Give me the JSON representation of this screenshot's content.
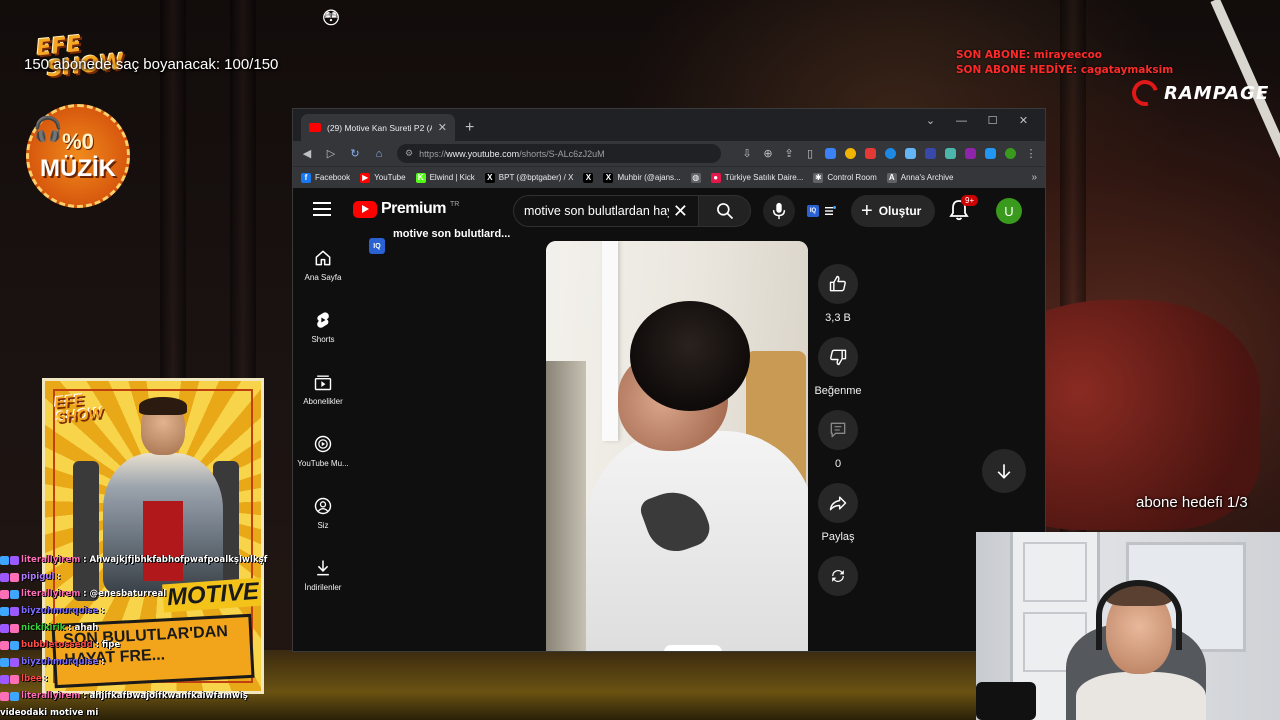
{
  "stream": {
    "goal_text": "150 abonede saç boyanacak: 100/150",
    "logo_line1": "EFE",
    "logo_line2": "SHOW",
    "badge_percent": "%0",
    "badge_word": "MÜZİK",
    "last_sub": "SON ABONE: mirayeecoo",
    "last_gift": "SON ABONE HEDİYE: cagataymaksim",
    "sponsor": "RAMPAGE",
    "sub_goal": "abone hedefi 1/3",
    "poster": {
      "logo1": "EFE",
      "logo2": "SHOW",
      "motive": "MOTIVE",
      "banner1": "SON BULUTLAR'DAN",
      "banner2": "HAYAT FRE..."
    },
    "chat": [
      {
        "user": "literallyirem",
        "msg": ": Ahwajkjfjbhkfabhofpwafpoalkşlwlkşf",
        "color": "#ff6fb5"
      },
      {
        "user": "pipigul",
        "msg": ":",
        "color": "#b07cff"
      },
      {
        "user": "literallyirem",
        "msg": ": @enesbaturreal",
        "color": "#ff6fb5"
      },
      {
        "user": "biyzuhmurquise",
        "msg": ":",
        "color": "#7c6cff"
      },
      {
        "user": "nickikirik",
        "msg": ": ahah",
        "color": "#3ecf3e"
      },
      {
        "user": "bubbletossedd",
        "msg": ": fipe",
        "color": "#ff4a4a"
      },
      {
        "user": "biyzuhmurquise",
        "msg": ":",
        "color": "#7c6cff"
      },
      {
        "user": "lbee",
        "msg": ":",
        "color": "#ff4a4a"
      },
      {
        "user": "literallyirem",
        "msg": ": ahjifkafbwajoifkwanfkaiwfamwiş",
        "color": "#ff6fb5"
      },
      {
        "user": "",
        "msg": "videodaki motive mi",
        "color": "#ffffff"
      }
    ]
  },
  "browser": {
    "tab_title": "(29) Motive Kan Sureti P2 (A",
    "url_prefix": "https://",
    "url_host": "www.youtube.com",
    "url_path": "/shorts/S-ALc6zJ2uM",
    "bookmarks": [
      {
        "label": "Facebook",
        "color": "#1877f2",
        "glyph": "f"
      },
      {
        "label": "YouTube",
        "color": "#ff0000",
        "glyph": "▶"
      },
      {
        "label": "Elwind | Kick",
        "color": "#53fc18",
        "glyph": "K"
      },
      {
        "label": "BPT (@bptgaber) / X",
        "color": "#000000",
        "glyph": "X"
      },
      {
        "label": "",
        "color": "#000000",
        "glyph": "X"
      },
      {
        "label": "Muhbir (@ajans...",
        "color": "#000000",
        "glyph": "X"
      },
      {
        "label": "",
        "color": "#5f6368",
        "glyph": "◍"
      },
      {
        "label": "Türkiye Satılık Daire...",
        "color": "#e3174a",
        "glyph": "●"
      },
      {
        "label": "Control Room",
        "color": "#5f6368",
        "glyph": "✱"
      },
      {
        "label": "Anna's Archive",
        "color": "#5f6368",
        "glyph": "A"
      }
    ]
  },
  "youtube": {
    "brand": "Premium",
    "region": "TR",
    "search_query": "motive son bulutlardan hayat",
    "create_label": "Oluştur",
    "notif_count": "9+",
    "avatar_letter": "U",
    "short_title": "motive son bulutlard...",
    "sidebar": [
      {
        "label": "Ana Sayfa",
        "icon": "home-icon"
      },
      {
        "label": "Shorts",
        "icon": "shorts-icon"
      },
      {
        "label": "Abonelikler",
        "icon": "subscriptions-icon"
      },
      {
        "label": "YouTube Mu...",
        "icon": "youtube-music-icon"
      },
      {
        "label": "Siz",
        "icon": "you-icon"
      },
      {
        "label": "İndirilenler",
        "icon": "downloads-icon"
      }
    ],
    "actions": {
      "likes": "3,3 B",
      "dislike_label": "Beğenme",
      "comments": "0",
      "share_label": "Paylaş"
    }
  }
}
